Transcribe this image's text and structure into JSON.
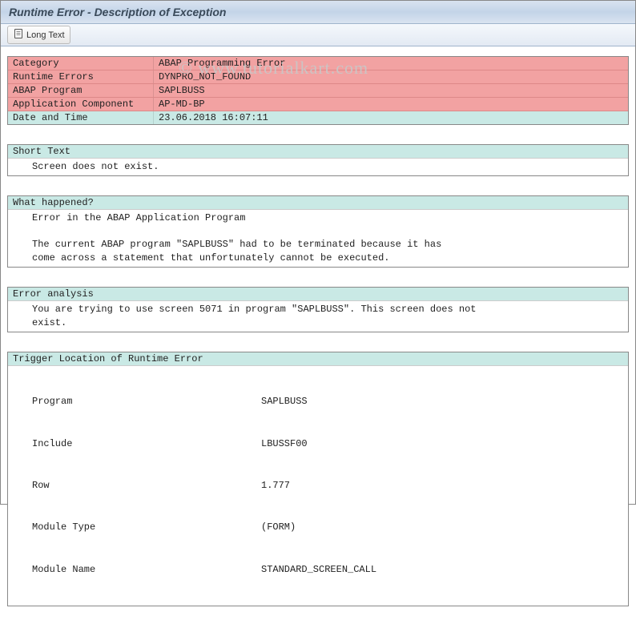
{
  "header": {
    "title": "Runtime Error - Description of Exception"
  },
  "toolbar": {
    "long_text_label": "Long Text"
  },
  "watermark": "© www.tutorialkart.com",
  "category_table": [
    {
      "label": "Category",
      "value": "ABAP Programming Error",
      "style": "pink"
    },
    {
      "label": "Runtime Errors",
      "value": "DYNPRO_NOT_FOUND",
      "style": "pink"
    },
    {
      "label": "ABAP Program",
      "value": "SAPLBUSS",
      "style": "pink"
    },
    {
      "label": "Application Component",
      "value": "AP-MD-BP",
      "style": "pink"
    },
    {
      "label": "Date and Time",
      "value": "23.06.2018 16:07:11",
      "style": "teal"
    }
  ],
  "sections": {
    "short_text": {
      "title": "Short Text",
      "body": "Screen does not exist."
    },
    "what_happened": {
      "title": "What happened?",
      "body": "Error in the ABAP Application Program\n\nThe current ABAP program \"SAPLBUSS\" had to be terminated because it has\ncome across a statement that unfortunately cannot be executed."
    },
    "error_analysis": {
      "title": "Error analysis",
      "body": "You are trying to use screen 5071 in program \"SAPLBUSS\". This screen does not\nexist."
    },
    "trigger": {
      "title": "Trigger Location of Runtime Error",
      "rows": [
        {
          "label": "Program",
          "value": "SAPLBUSS"
        },
        {
          "label": "Include",
          "value": "LBUSSF00"
        },
        {
          "label": "Row",
          "value": "1.777"
        },
        {
          "label": "Module Type",
          "value": "(FORM)"
        },
        {
          "label": "Module Name",
          "value": "STANDARD_SCREEN_CALL"
        }
      ]
    }
  }
}
